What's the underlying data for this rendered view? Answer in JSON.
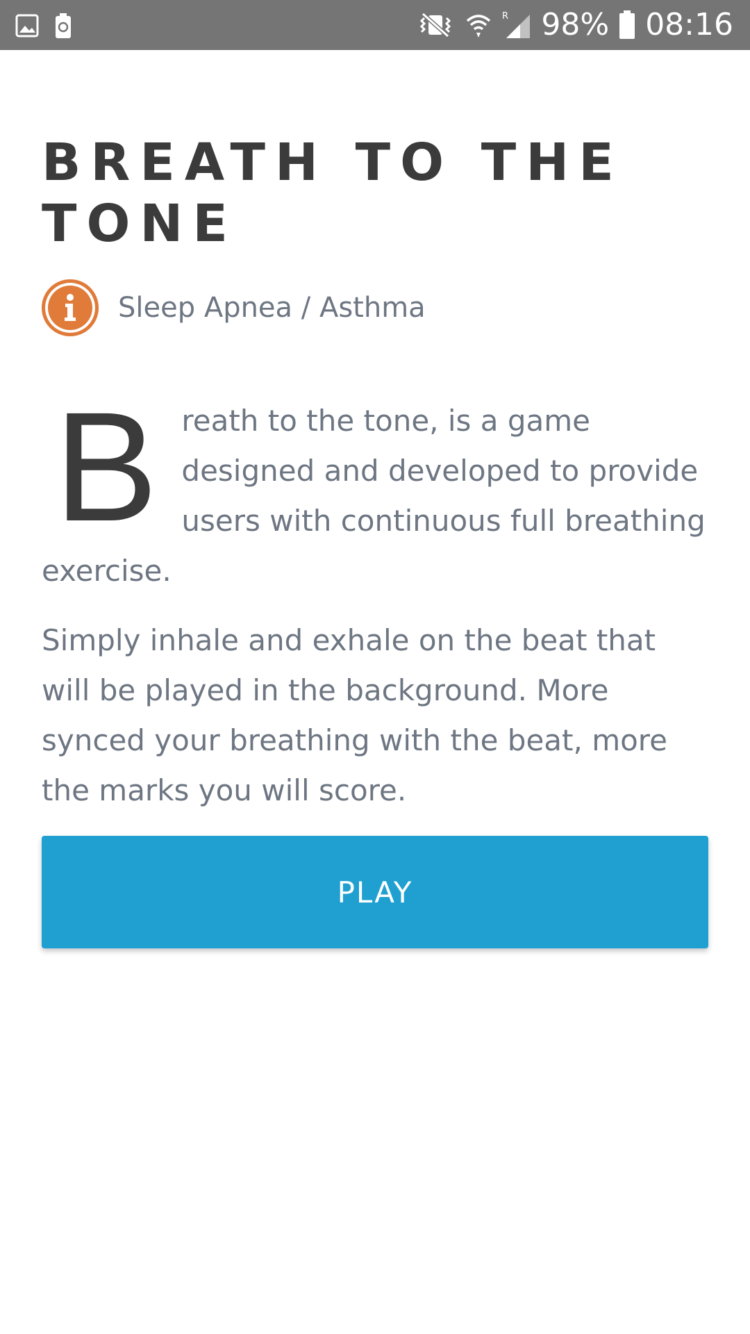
{
  "status_bar": {
    "battery": "98%",
    "time": "08:16",
    "icons": [
      "gallery-icon",
      "battery-saver-icon",
      "vibrate-mute-icon",
      "wifi-icon",
      "signal-roaming-icon",
      "battery-icon"
    ]
  },
  "game": {
    "title": "BREATH TO THE TONE",
    "category": "Sleep Apnea / Asthma",
    "category_icon": "info-icon",
    "accent_color": "#e07b39",
    "dropcap": "B",
    "paragraph1_rest": "reath to the tone, is a game designed and developed to provide users with continuous full breathing exercise.",
    "paragraph2": "Simply inhale and exhale on the beat that will be played in the background. More synced your breathing with the beat, more the marks you will score."
  },
  "actions": {
    "play_label": "PLAY",
    "play_color": "#1fa0d1"
  }
}
